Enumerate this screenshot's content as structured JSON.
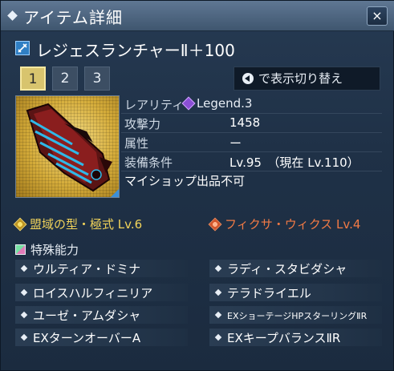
{
  "window": {
    "title": "アイテム詳細",
    "close_label": "×"
  },
  "item": {
    "name": "レジェスランチャーⅡ＋100",
    "tabs": [
      "1",
      "2",
      "3"
    ],
    "selected_tab": "1",
    "toggle_label": "で表示切り替え",
    "stats": {
      "rarity_label": "レアリティ",
      "rarity_value": "Legend.3",
      "attack_label": "攻撃力",
      "attack_value": "1458",
      "element_label": "属性",
      "element_value": "ー",
      "requirement_label": "装備条件",
      "requirement_value": "Lv.95　（現在  Lv.110）",
      "shop_note": "マイショップ出品不可"
    },
    "class_left": "盟域の型・極式 Lv.6",
    "class_right": "フィクサ・ウィクス  Lv.4",
    "special_header": "特殊能力",
    "special_abilities": [
      "ウルティア・ドミナ",
      "ラディ・スタビダシャ",
      "ロイスハルフィニリア",
      "テラドライエル",
      "ユーゼ・アムダシャ",
      "EXショーテージHPスターリングⅡR",
      "EXターンオーバーA",
      "EXキープバランスⅡR"
    ]
  },
  "colors": {
    "class_left": "#f1d35a",
    "class_right": "#f27a45",
    "rarity_gem": "#8b4fd6",
    "selected_tab": "#d8c46e"
  }
}
